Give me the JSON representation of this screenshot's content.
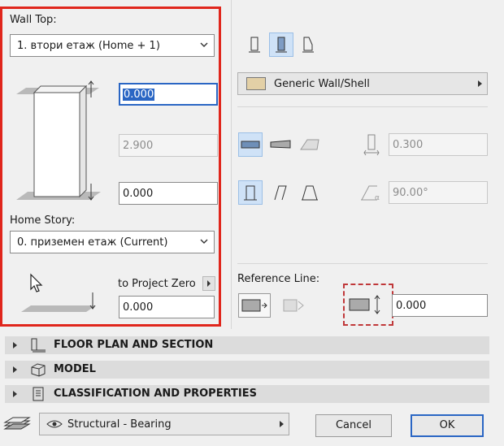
{
  "wall_top": {
    "label": "Wall Top:",
    "story_select": "1. втори етаж (Home + 1)",
    "top_offset": "0.000",
    "height": "2.900",
    "base_offset": "0.000"
  },
  "home_story": {
    "label": "Home Story:",
    "story_select": "0. приземен етаж (Current)",
    "to_project_zero_label": "to Project Zero",
    "to_project_zero_value": "0.000"
  },
  "right_panel": {
    "material_select": "Generic Wall/Shell",
    "thickness": "0.300",
    "angle": "90.00°",
    "reference_line_label": "Reference Line:",
    "reference_offset": "0.000"
  },
  "sections": [
    {
      "label": "FLOOR PLAN AND SECTION",
      "icon": "floor-plan-icon"
    },
    {
      "label": "MODEL",
      "icon": "model-box-icon"
    },
    {
      "label": "CLASSIFICATION AND PROPERTIES",
      "icon": "document-icon"
    }
  ],
  "footer": {
    "layer_select": "Structural - Bearing",
    "cancel_label": "Cancel",
    "ok_label": "OK"
  },
  "colors": {
    "highlight_red": "#e0261c",
    "focus_blue": "#2a66c4",
    "active_icon_bg": "#cfe2f7"
  }
}
